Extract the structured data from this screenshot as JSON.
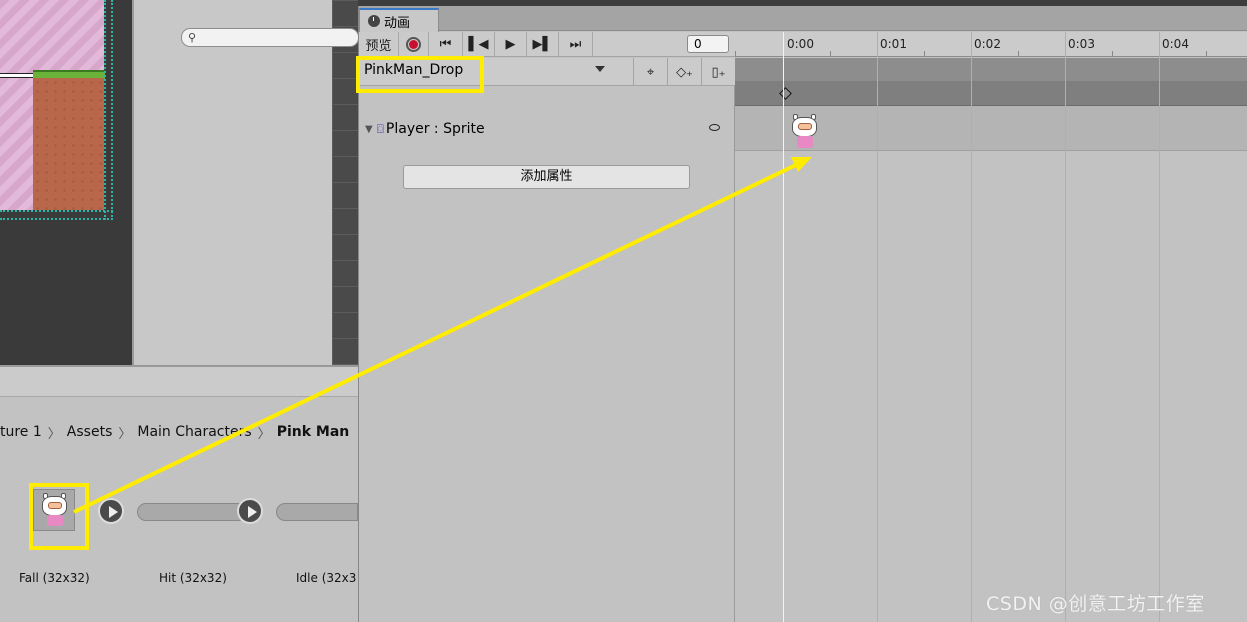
{
  "animation_window": {
    "tab_label": "动画",
    "toolbar": {
      "preview_label": "预览",
      "record_icon": "record-icon",
      "first_key_icon": "first-keyframe-icon",
      "prev_key_icon": "prev-keyframe-icon",
      "play_icon": "play-icon",
      "next_key_icon": "next-keyframe-icon",
      "last_key_icon": "last-keyframe-icon",
      "frame_value": "0"
    },
    "clip_name": "PinkMan_Drop",
    "clip_tools": [
      "crosshair-icon",
      "add-keyframe-icon",
      "add-event-icon"
    ],
    "property": {
      "label": "Player : Sprite"
    },
    "add_property_label": "添加属性",
    "timeline": {
      "ticks": [
        "0:00",
        "0:01",
        "0:02",
        "0:03",
        "0:04"
      ],
      "current_time": "0:00"
    }
  },
  "project_panel": {
    "breadcrumb": [
      "ture 1",
      "Assets",
      "Main Characters",
      "Pink Man"
    ],
    "assets": [
      {
        "label": "Fall (32x32)"
      },
      {
        "label": "Hit (32x32)"
      },
      {
        "label": "Idle (32x3"
      }
    ]
  },
  "watermark": "CSDN @创意工坊工作室",
  "colors": {
    "highlight": "#ffec00",
    "record_red": "#c8102e"
  }
}
